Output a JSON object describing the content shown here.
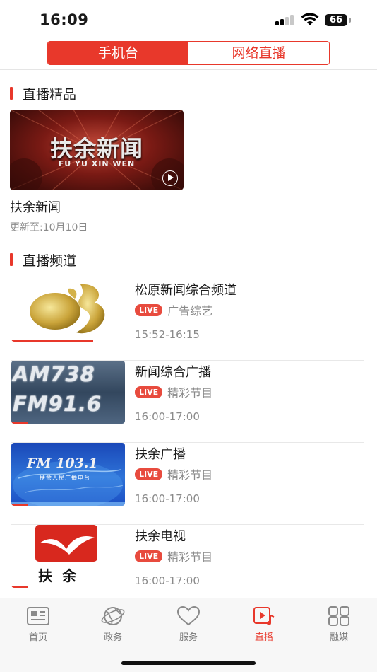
{
  "status_bar": {
    "time": "16:09",
    "battery": "66"
  },
  "segment": {
    "tab1": "手机台",
    "tab2": "网络直播"
  },
  "featured_section": {
    "title": "直播精品",
    "item": {
      "logo_cn": "扶余新闻",
      "logo_en": "FU YU XIN WEN",
      "title": "扶余新闻",
      "update": "更新至:10月10日"
    }
  },
  "channels_section": {
    "title": "直播频道",
    "items": [
      {
        "name": "松原新闻综合频道",
        "live": "LIVE",
        "desc": "广告综艺",
        "time": "15:52-16:15",
        "progress": 0.72
      },
      {
        "name": "新闻综合广播",
        "live": "LIVE",
        "desc": "精彩节目",
        "time": "16:00-17:00",
        "progress": 0.15,
        "thumb_line1": "AM738",
        "thumb_line2": "FM91.6"
      },
      {
        "name": "扶余广播",
        "live": "LIVE",
        "desc": "精彩节目",
        "time": "16:00-17:00",
        "progress": 0.15,
        "thumb_main": "FM 103.1",
        "thumb_sub": "扶余人民广播电台"
      },
      {
        "name": "扶余电视",
        "live": "LIVE",
        "desc": "精彩节目",
        "time": "16:00-17:00",
        "progress": 0.15,
        "thumb_text": "扶余"
      }
    ]
  },
  "tab_bar": {
    "items": [
      {
        "label": "首页",
        "icon": "news-icon"
      },
      {
        "label": "政务",
        "icon": "globe-icon"
      },
      {
        "label": "服务",
        "icon": "heart-icon"
      },
      {
        "label": "直播",
        "icon": "live-play-icon"
      },
      {
        "label": "融媒",
        "icon": "grid-icon"
      }
    ],
    "active_index": 3,
    "accent": "#e8382b"
  }
}
